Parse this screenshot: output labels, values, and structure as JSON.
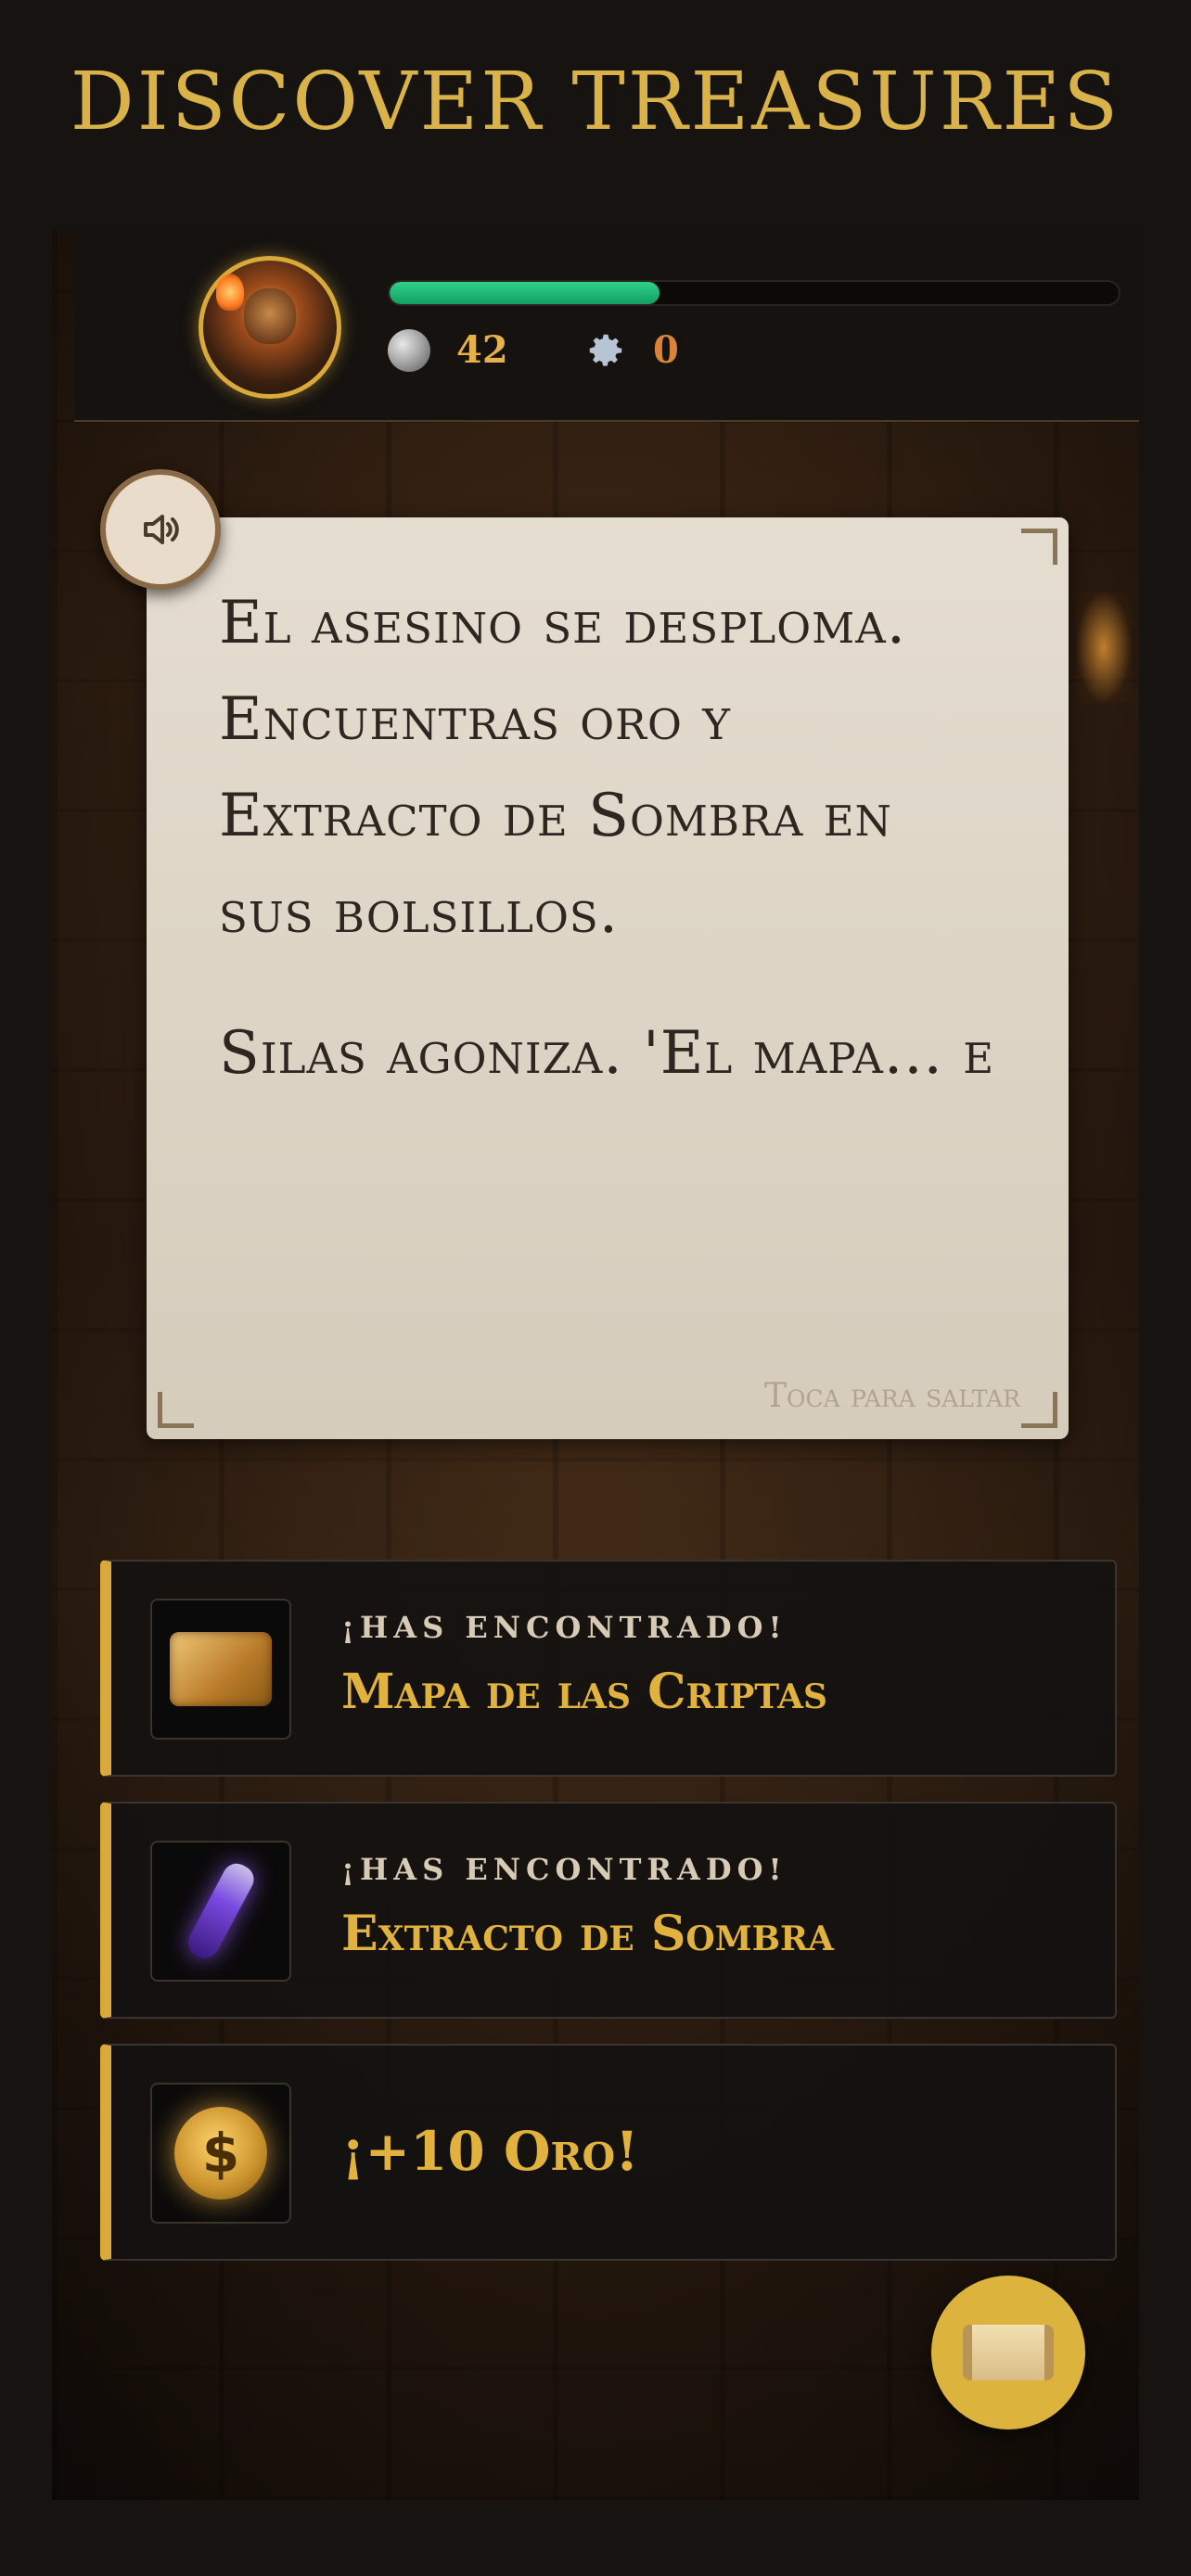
{
  "title": "DISCOVER TREASURES",
  "header": {
    "progress_fraction": 0.37,
    "coins": "42",
    "xp": "0"
  },
  "dialog": {
    "paragraphs": [
      "El asesino se desploma. Encuentras oro y Extracto de Sombra en sus bolsillos.",
      "Silas agoniza. 'El mapa... e"
    ],
    "skip_hint": "Toca para saltar"
  },
  "loot": [
    {
      "kicker": "¡HAS ENCONTRADO!",
      "name": "Mapa de las Criptas",
      "icon": "treasure-map-icon"
    },
    {
      "kicker": "¡HAS ENCONTRADO!",
      "name": "Extracto de Sombra",
      "icon": "shadow-vial-icon"
    },
    {
      "kicker": "",
      "name": "¡+10 Oro!",
      "icon": "money-bag-icon"
    }
  ],
  "colors": {
    "accent_gold": "#d9b24a",
    "progress_green": "#2fd08a",
    "parchment": "#e5ddd0"
  }
}
